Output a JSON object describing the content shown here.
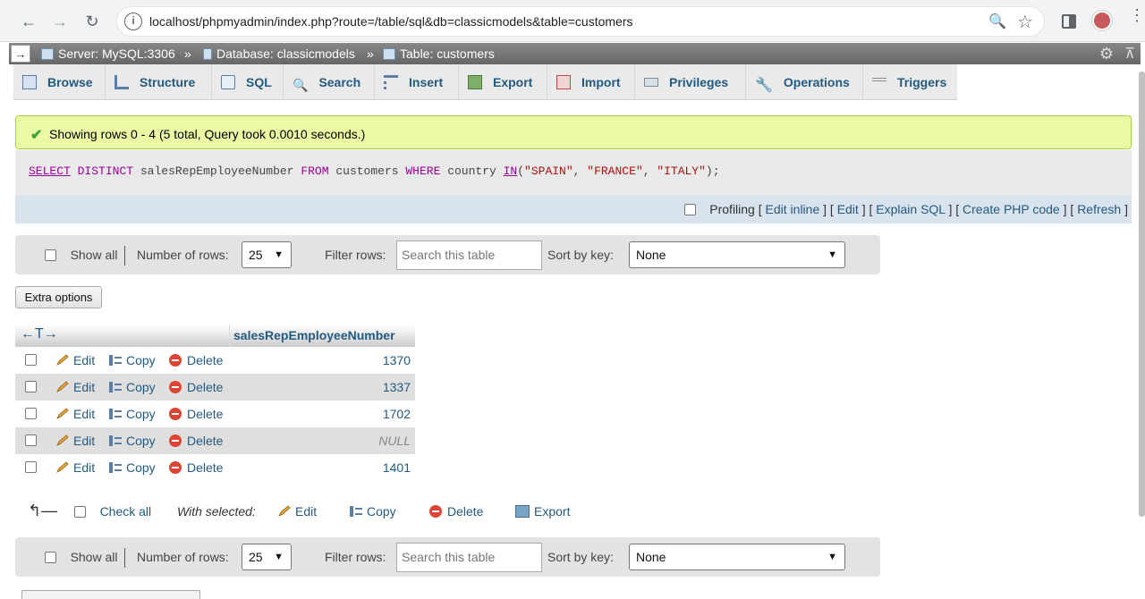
{
  "browser": {
    "url": "localhost/phpmyadmin/index.php?route=/table/sql&db=classicmodels&table=customers"
  },
  "breadcrumb": {
    "server": "Server: MySQL:3306",
    "database": "Database: classicmodels",
    "table": "Table: customers",
    "separator": "»"
  },
  "tabs": [
    {
      "label": "Browse"
    },
    {
      "label": "Structure"
    },
    {
      "label": "SQL"
    },
    {
      "label": "Search"
    },
    {
      "label": "Insert"
    },
    {
      "label": "Export"
    },
    {
      "label": "Import"
    },
    {
      "label": "Privileges"
    },
    {
      "label": "Operations"
    },
    {
      "label": "Triggers"
    }
  ],
  "message": "Showing rows 0 - 4 (5 total, Query took 0.0010 seconds.)",
  "sql": {
    "select": "SELECT",
    "distinct": "DISTINCT",
    "column": "salesRepEmployeeNumber",
    "from": "FROM",
    "table": "customers",
    "where": "WHERE",
    "field": "country",
    "in": "IN",
    "open": "(",
    "v1": "\"SPAIN\"",
    "v2": "\"FRANCE\"",
    "v3": "\"ITALY\"",
    "close": ");",
    "comma": ", "
  },
  "sql_actions": {
    "profiling": "Profiling",
    "edit_inline": "Edit inline",
    "edit": "Edit",
    "explain": "Explain SQL",
    "create_php": "Create PHP code",
    "refresh": "Refresh",
    "open_bracket": "[",
    "close_bracket": "]"
  },
  "navbar": {
    "show_all": "Show all",
    "number_of_rows": "Number of rows:",
    "rows_value": "25",
    "filter_rows": "Filter rows:",
    "filter_placeholder": "Search this table",
    "sort_by_key": "Sort by key:",
    "sort_value": "None"
  },
  "extra_options": "Extra options",
  "table": {
    "column": "salesRepEmployeeNumber",
    "arrows": "←T→",
    "row_actions": {
      "edit": "Edit",
      "copy": "Copy",
      "delete": "Delete"
    },
    "rows": [
      {
        "value": "1370"
      },
      {
        "value": "1337"
      },
      {
        "value": "1702"
      },
      {
        "value": "NULL"
      },
      {
        "value": "1401"
      }
    ]
  },
  "bulk": {
    "check_all": "Check all",
    "with_selected": "With selected:",
    "edit": "Edit",
    "copy": "Copy",
    "delete": "Delete",
    "export": "Export"
  }
}
